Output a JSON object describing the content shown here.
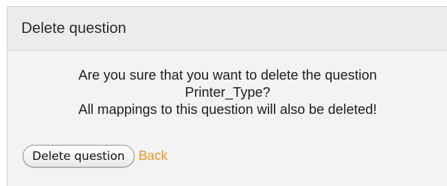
{
  "dialog": {
    "title": "Delete question",
    "message": {
      "line1": "Are you sure that you want to delete the question",
      "line2": "Printer_Type?",
      "line3": "All mappings to this question will also be deleted!"
    },
    "actions": {
      "delete_label": "Delete question",
      "back_label": "Back"
    }
  },
  "colors": {
    "link": "#f0901f",
    "panel_bg": "#f3f3f3",
    "header_bg": "#ececec"
  }
}
